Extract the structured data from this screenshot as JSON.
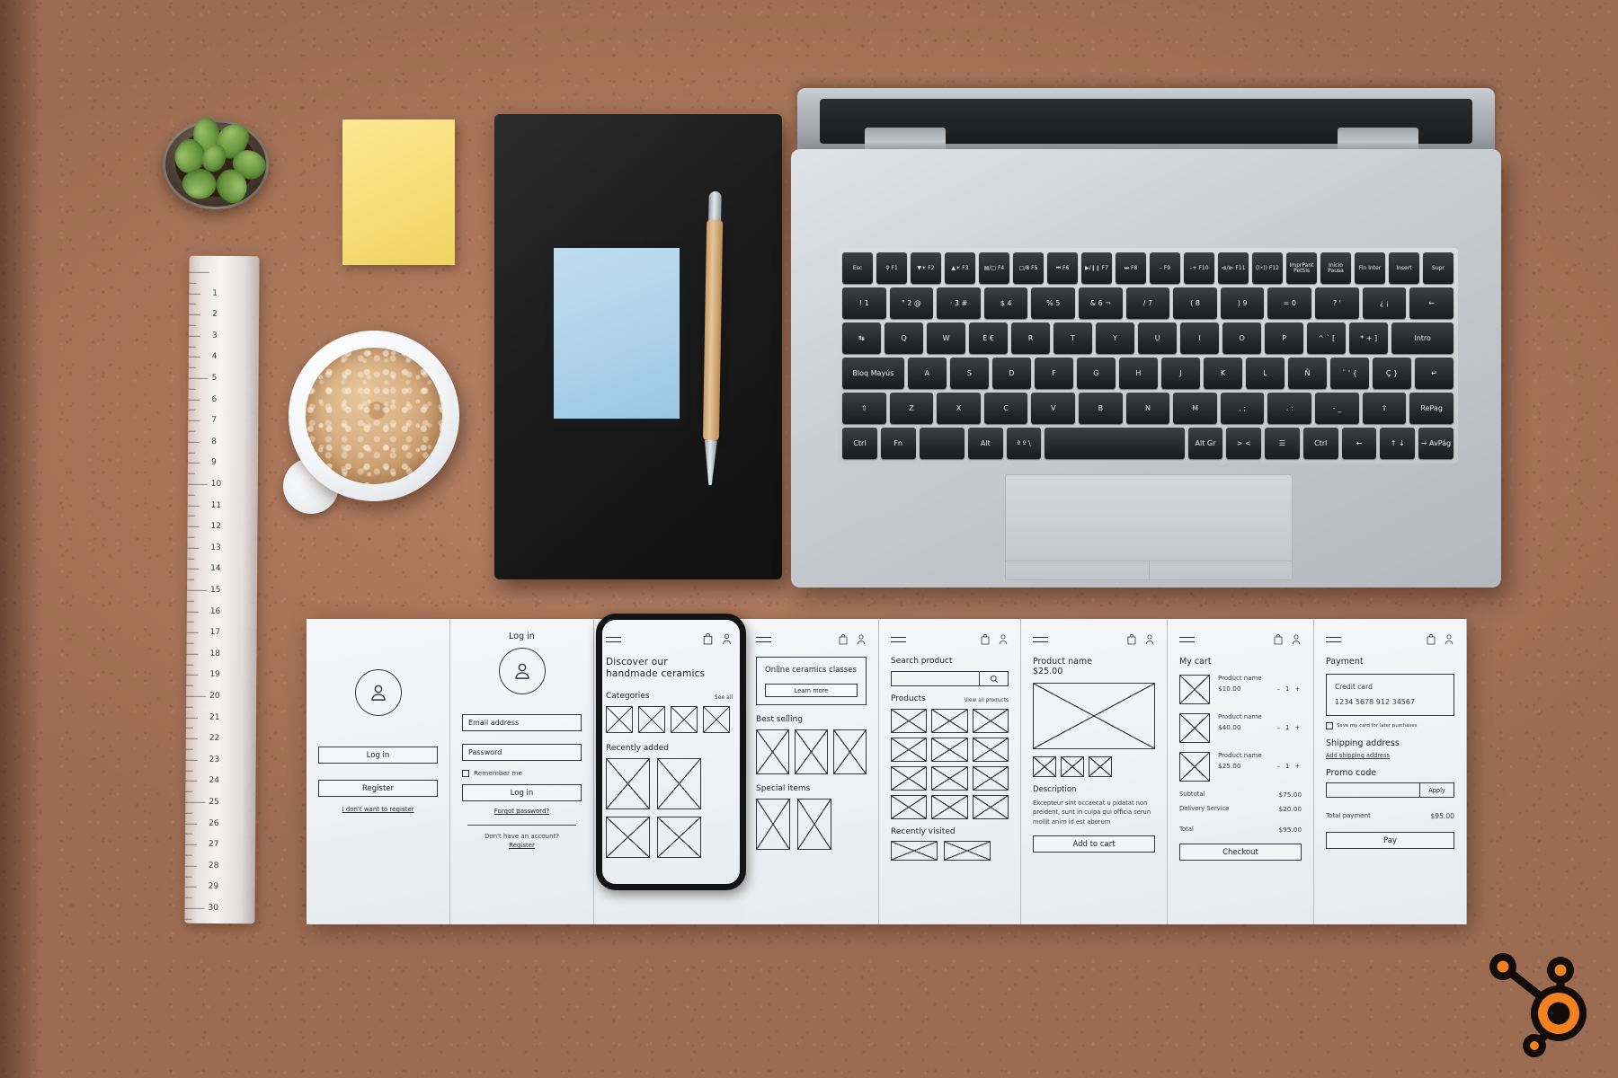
{
  "scene": {
    "title": "Flat-lay desk with UX wireframe storyboard",
    "desk_color": "#a8755a",
    "objects": [
      "succulent-plant",
      "sticky-note",
      "ruler",
      "coffee-cup",
      "notebook",
      "blue-card",
      "pen",
      "laptop",
      "wireframe-strip",
      "logo"
    ]
  },
  "laptop": {
    "keyboard_layout": "Spanish (ES)",
    "rows": [
      [
        "Esc",
        "⚲ F1",
        "▼☀ F2",
        "▲☀ F3",
        "▤/□ F4",
        "□/8 F5",
        "⏮ F6",
        "▶/❙❙ F7",
        "⏭ F8",
        "– F9",
        "–+ F10",
        "⧏/⧐ F11",
        "((•)) F12",
        "ImprPant PetSis",
        "Inicio Pausa",
        "Fin Inter",
        "Insert",
        "Supr"
      ],
      [
        "! 1",
        "\" 2 @",
        "· 3 #",
        "$ 4",
        "% 5",
        "& 6 ¬",
        "/ 7",
        "( 8",
        ") 9",
        "= 0",
        "? '",
        "¿ ¡",
        "←"
      ],
      [
        "↹",
        "Q",
        "W",
        "E €",
        "R",
        "T",
        "Y",
        "U",
        "I",
        "O",
        "P",
        "^ ` [",
        "* + ]",
        "Intro"
      ],
      [
        "Bloq Mayús",
        "A",
        "S",
        "D",
        "F",
        "G",
        "H",
        "J",
        "K",
        "L",
        "Ñ",
        "¨ ' {",
        "Ç }",
        "↵"
      ],
      [
        "⇧",
        "Z",
        "X",
        "C",
        "V",
        "B",
        "N",
        "M",
        ", ;",
        ". :",
        "- _",
        "⇧",
        "RePag"
      ],
      [
        "Ctrl",
        "Fn",
        "",
        "Alt",
        "ª º \\",
        "",
        "Alt Gr",
        ">  <",
        "☰",
        "Ctrl",
        "←",
        "↑ ↓",
        "→ AvPág"
      ]
    ]
  },
  "wireframes": {
    "panels": [
      {
        "id": "auth",
        "name": "auth-panel",
        "avatar_icon": "user-avatar-icon",
        "buttons": [
          "Log in",
          "Register"
        ],
        "link": "I don't want to register"
      },
      {
        "id": "login",
        "name": "login-panel",
        "title": "Log in",
        "avatar_icon": "user-avatar-icon",
        "fields": [
          "Email address",
          "Password"
        ],
        "checkbox_label": "Remember me",
        "submit_label": "Log in",
        "forgot_link": "Forgot password?",
        "footer_text": "Don't have an account?",
        "footer_link": "Register"
      },
      {
        "id": "phone",
        "name": "mobile-home-panel",
        "highlighted": true,
        "menu_icon": "hamburger-menu-icon",
        "bag_icon": "shopping-bag-icon",
        "user_icon": "user-icon",
        "headline": "Discover our\nhandmade ceramics",
        "section_categories": "Categories",
        "see_all": "See all",
        "category_count": 4,
        "section_recent": "Recently added",
        "recent_count": 4
      },
      {
        "id": "home",
        "name": "home-panel",
        "menu_icon": "hamburger-menu-icon",
        "bag_icon": "shopping-bag-icon",
        "user_icon": "user-icon",
        "banner_title": "Online ceramics classes",
        "banner_button": "Learn more",
        "section_best": "Best selling",
        "best_count": 3,
        "section_special": "Special items",
        "special_count": 2
      },
      {
        "id": "search",
        "name": "search-panel",
        "menu_icon": "hamburger-menu-icon",
        "bag_icon": "shopping-bag-icon",
        "user_icon": "user-icon",
        "title": "Search product",
        "search_placeholder": "",
        "search_icon": "magnifier-icon",
        "section_products": "Products",
        "view_all": "View all products",
        "grid_rows": 4,
        "grid_cols": 3,
        "section_recent": "Recently visited",
        "recent_count": 2
      },
      {
        "id": "product",
        "name": "product-detail-panel",
        "menu_icon": "hamburger-menu-icon",
        "bag_icon": "shopping-bag-icon",
        "user_icon": "user-icon",
        "product_name": "Product name",
        "price": "$25.00",
        "thumb_count": 3,
        "description_title": "Description",
        "description_body": "Excepteur sint occaecat u pidatat non preident, sunt in culpa qui officia serun mollit anim id est aborum",
        "cta": "Add to cart"
      },
      {
        "id": "cart",
        "name": "cart-panel",
        "menu_icon": "hamburger-menu-icon",
        "bag_icon": "shopping-bag-icon",
        "user_icon": "user-icon",
        "title": "My cart",
        "items": [
          {
            "name": "Product name",
            "price": "$10.00",
            "qty": "1"
          },
          {
            "name": "Product name",
            "price": "$40.00",
            "qty": "1"
          },
          {
            "name": "Product name",
            "price": "$25.00",
            "qty": "1"
          }
        ],
        "qty_minus": "–",
        "qty_plus": "+",
        "totals": [
          {
            "label": "Subtotal",
            "value": "$75.00"
          },
          {
            "label": "Delivery Service",
            "value": "$20.00"
          },
          {
            "label": "Total",
            "value": "$95.00"
          }
        ],
        "cta": "Checkout"
      },
      {
        "id": "payment",
        "name": "payment-panel",
        "menu_icon": "hamburger-menu-icon",
        "bag_icon": "shopping-bag-icon",
        "user_icon": "user-icon",
        "title": "Payment",
        "card_label": "Credit card",
        "card_number": "1234 5678 912 34567",
        "save_card_label": "Save my card for later purchases",
        "shipping_title": "Shipping address",
        "shipping_link": "Add shipping address",
        "promo_title": "Promo code",
        "promo_value": "",
        "promo_button": "Apply",
        "total_label": "Total payment",
        "total_value": "$95.00",
        "cta": "Pay"
      }
    ]
  },
  "logo": {
    "name": "hubspot-sprocket-logo",
    "colors": {
      "outline": "#120d0a",
      "accent": "#f2821f"
    }
  }
}
